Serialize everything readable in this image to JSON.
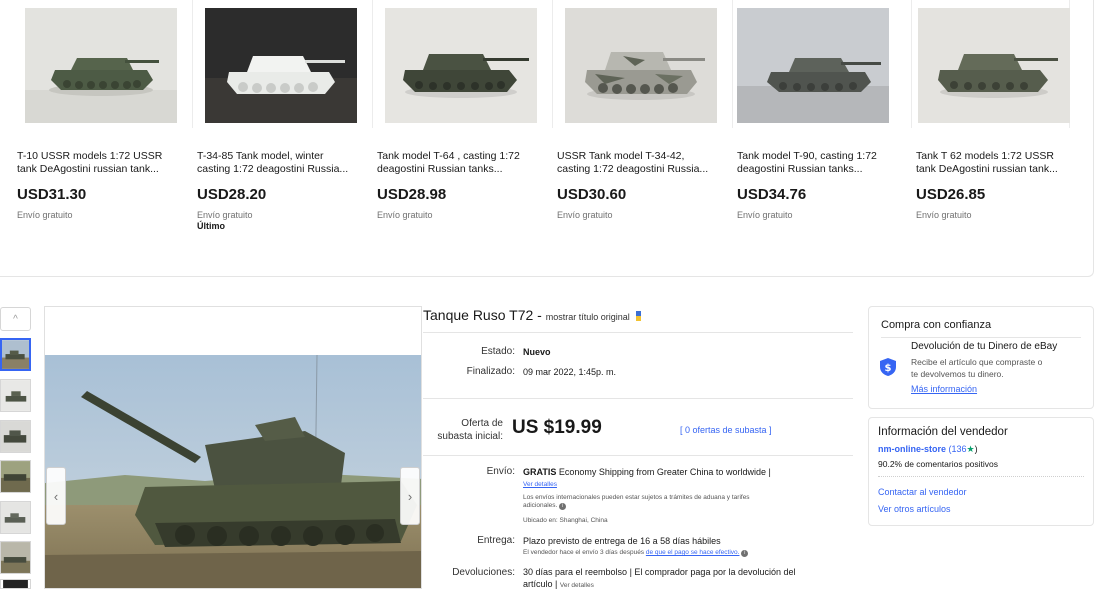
{
  "related": [
    {
      "title": "T-10 USSR models 1:72 USSR tank DeAgostini russian tank...",
      "price": "USD31.30",
      "shipping": "Envío gratuito",
      "extra": ""
    },
    {
      "title": "T-34-85 Tank model, winter casting 1:72 deagostini Russia...",
      "price": "USD28.20",
      "shipping": "Envío gratuito",
      "extra": "Último"
    },
    {
      "title": "Tank model T-64 , casting 1:72 deagostini Russian tanks...",
      "price": "USD28.98",
      "shipping": "Envío gratuito",
      "extra": ""
    },
    {
      "title": "USSR Tank model T-34-42, casting 1:72 deagostini Russia...",
      "price": "USD30.60",
      "shipping": "Envío gratuito",
      "extra": ""
    },
    {
      "title": "Tank model T-90, casting 1:72 deagostini Russian tanks...",
      "price": "USD34.76",
      "shipping": "Envío gratuito",
      "extra": ""
    },
    {
      "title": "Tank T 62 models 1:72 USSR tank DeAgostini russian tank...",
      "price": "USD26.85",
      "shipping": "Envío gratuito",
      "extra": ""
    }
  ],
  "item": {
    "title": "Tanque Ruso T72",
    "show_original": "mostrar título original",
    "condition_label": "Estado:",
    "condition": "Nuevo",
    "ended_label": "Finalizado:",
    "ended": "09 mar 2022, 1:45p. m.",
    "bid_label_1": "Oferta de",
    "bid_label_2": "subasta inicial:",
    "price": "US $19.99",
    "bids": "[ 0 ofertas de subasta ]",
    "shipping_label": "Envío:",
    "shipping_free": "GRATIS",
    "shipping_service": "Economy Shipping from Greater China to worldwide |",
    "shipping_details": "Ver detalles",
    "shipping_note_1": "Los envíos internacionales pueden estar sujetos a trámites de aduana y tarifes",
    "shipping_note_2": "adicionales.",
    "located_label": "Ubicado en:",
    "located": "Shanghai, China",
    "delivery_label": "Entrega:",
    "delivery": "Plazo previsto de entrega de 16 a 58 días hábiles",
    "delivery_note_prefix": "El vendedor hace el envío 3 días después",
    "delivery_note_link": "de que el pago se hace efectivo.",
    "returns_label": "Devoluciones:",
    "returns": "30 días para el reembolso | El comprador paga por la devolución del",
    "returns_2": "artículo |",
    "returns_details": "Ver detalles"
  },
  "trust": {
    "title": "Compra con confianza",
    "heading": "Devolución de tu Dinero de eBay",
    "text_1": "Recibe el artículo que compraste o",
    "text_2": "te devolvemos tu dinero.",
    "more": "Más información"
  },
  "seller": {
    "title": "Información del vendedor",
    "name": "nm-online-store",
    "score": "(136",
    "score_end": ")",
    "positive": "90.2% de comentarios positivos",
    "contact": "Contactar al vendedor",
    "other": "Ver otros artículos"
  },
  "gallery": {
    "up_arrow": "^",
    "prev": "‹",
    "next": "›"
  },
  "colors": {
    "link": "#3665f3",
    "text": "#191919",
    "muted": "#707070"
  }
}
